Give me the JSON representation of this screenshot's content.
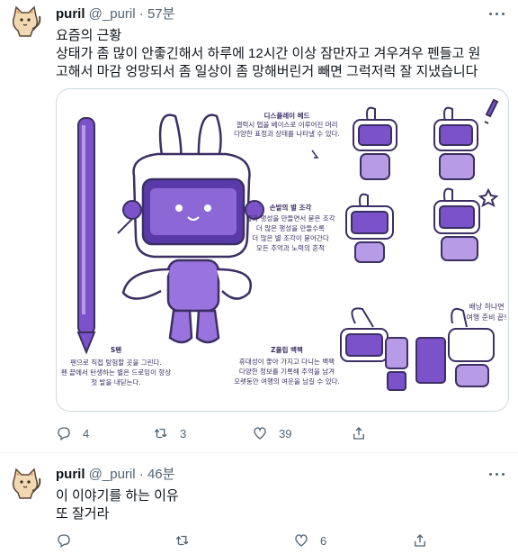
{
  "tweets": [
    {
      "author_name": "puril",
      "author_handle": "@_puril",
      "separator": "·",
      "time": "57분",
      "lines": [
        "요즘의 근황",
        "상태가 좀 많이 안좋긴해서 하루에 12시간 이상 잠만자고 겨우겨우 펜들고 원",
        "고해서 마감 엉망되서 좀 일상이 좀 망해버린거 빼면 그럭저럭 잘 지냈습니다"
      ],
      "image": {
        "caption_head_title": "디스플레이 헤드",
        "caption_head_lines": [
          "갤럭시 탭을 베이스로 이루어진 머리",
          "다양한 표정과 상태를 나타낼 수 있다."
        ],
        "caption_hand_title": "손발의 별 조각",
        "caption_hand_lines": [
          "별과 행성을 만들면서 묻은 조각",
          "더 많은 행성을 만들수록",
          "더 많은 별 조각이 묻어간다",
          "모든 추억과 노력의 흔적"
        ],
        "caption_pen_title": "S펜",
        "caption_pen_lines": [
          "펜으로 직접 탐험할 곳을 그린다.",
          "펜 끝에서 탄생하는 별은 드로잉이 항상",
          "첫 발을 내딛는다."
        ],
        "caption_bag_title": "Z플립 백팩",
        "caption_bag_lines": [
          "휴대성이 좋아 가지고 다니는 백팩",
          "다양한 정보를 기록해 추억을 남겨",
          "오랫동안 여행의 여운을 남길 수 있다."
        ],
        "caption_travel_lines": [
          "배낭 하나면",
          "여행 준비 끝!"
        ]
      },
      "actions": {
        "reply": "4",
        "retweet": "3",
        "like": "39",
        "share": ""
      }
    },
    {
      "author_name": "puril",
      "author_handle": "@_puril",
      "separator": "·",
      "time": "46분",
      "lines": [
        "이 이야기를 하는 이유",
        "또 잘거라"
      ],
      "actions": {
        "reply": "",
        "retweet": "",
        "like": "6",
        "share": ""
      }
    }
  ],
  "colors": {
    "text": "#0f1419",
    "meta": "#536471",
    "border": "#cfd9de",
    "purple": "#7b52c9",
    "light_purple": "#b89be6",
    "outline": "#3b2f63"
  },
  "icons": [
    "avatar-cat-icon",
    "more-icon",
    "reply-icon",
    "retweet-icon",
    "like-icon",
    "share-icon",
    "star-icon",
    "exclamation-icon"
  ]
}
